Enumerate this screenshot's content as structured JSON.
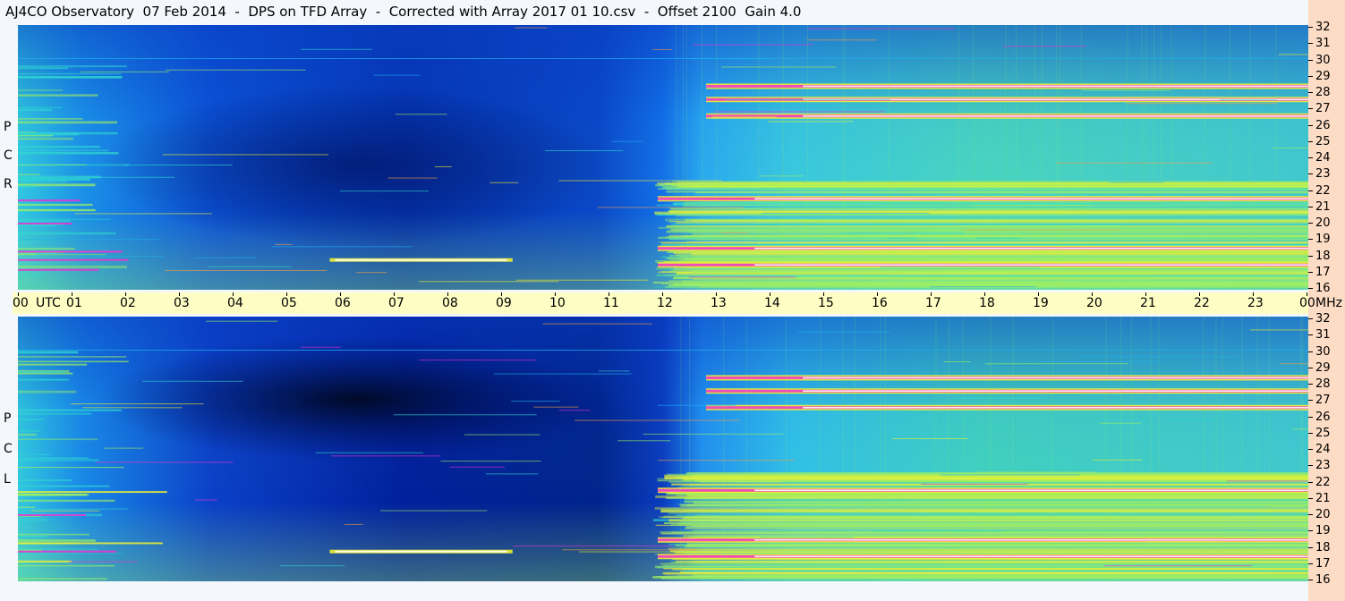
{
  "title": "AJ4CO Observatory  07 Feb 2014  -  DPS on TFD Array  -  Corrected with Array 2017 01 10.csv  -  Offset 2100  Gain 4.0",
  "panels": {
    "top": {
      "polarization_letters": [
        "R",
        "C",
        "P"
      ]
    },
    "bottom": {
      "polarization_letters": [
        "L",
        "C",
        "P"
      ]
    }
  },
  "time_axis": {
    "labels": [
      "00",
      "UTC",
      "01",
      "02",
      "03",
      "04",
      "05",
      "06",
      "07",
      "08",
      "09",
      "10",
      "11",
      "12",
      "13",
      "14",
      "15",
      "16",
      "17",
      "18",
      "19",
      "20",
      "21",
      "22",
      "23",
      "00",
      "MHz"
    ]
  },
  "freq_axis": {
    "labels": [
      "32",
      "31",
      "30",
      "29",
      "28",
      "27",
      "26",
      "25",
      "24",
      "23",
      "22",
      "21",
      "20",
      "19",
      "18",
      "17",
      "16"
    ]
  },
  "colors": {
    "right_strip": "#fcdcc4",
    "time_bar": "#fdfdc4",
    "colormap": [
      "#000a3c",
      "#001a8c",
      "#0040d0",
      "#1070f0",
      "#20b0f0",
      "#30d8d0",
      "#a0f060",
      "#f0f030",
      "#f8a040",
      "#f030d0",
      "#ffffff"
    ]
  },
  "chart_data": {
    "type": "heatmap",
    "title": "AJ4CO Observatory  07 Feb 2014  -  DPS on TFD Array  -  Corrected with Array 2017 01 10.csv  -  Offset 2100  Gain 4.0",
    "xlabel": "UTC",
    "ylabel": "MHz",
    "xlim": [
      0,
      24
    ],
    "ylim": [
      16,
      32
    ],
    "panels": [
      "RCP",
      "LCP"
    ],
    "description_of_intensity": {
      "quiet_period_utc": [
        2,
        12
      ],
      "active_period_utc": [
        12,
        24
      ],
      "strong_bands_mhz": [
        17.5,
        18.5,
        21.5,
        26.5,
        27.5,
        28.3
      ]
    }
  }
}
